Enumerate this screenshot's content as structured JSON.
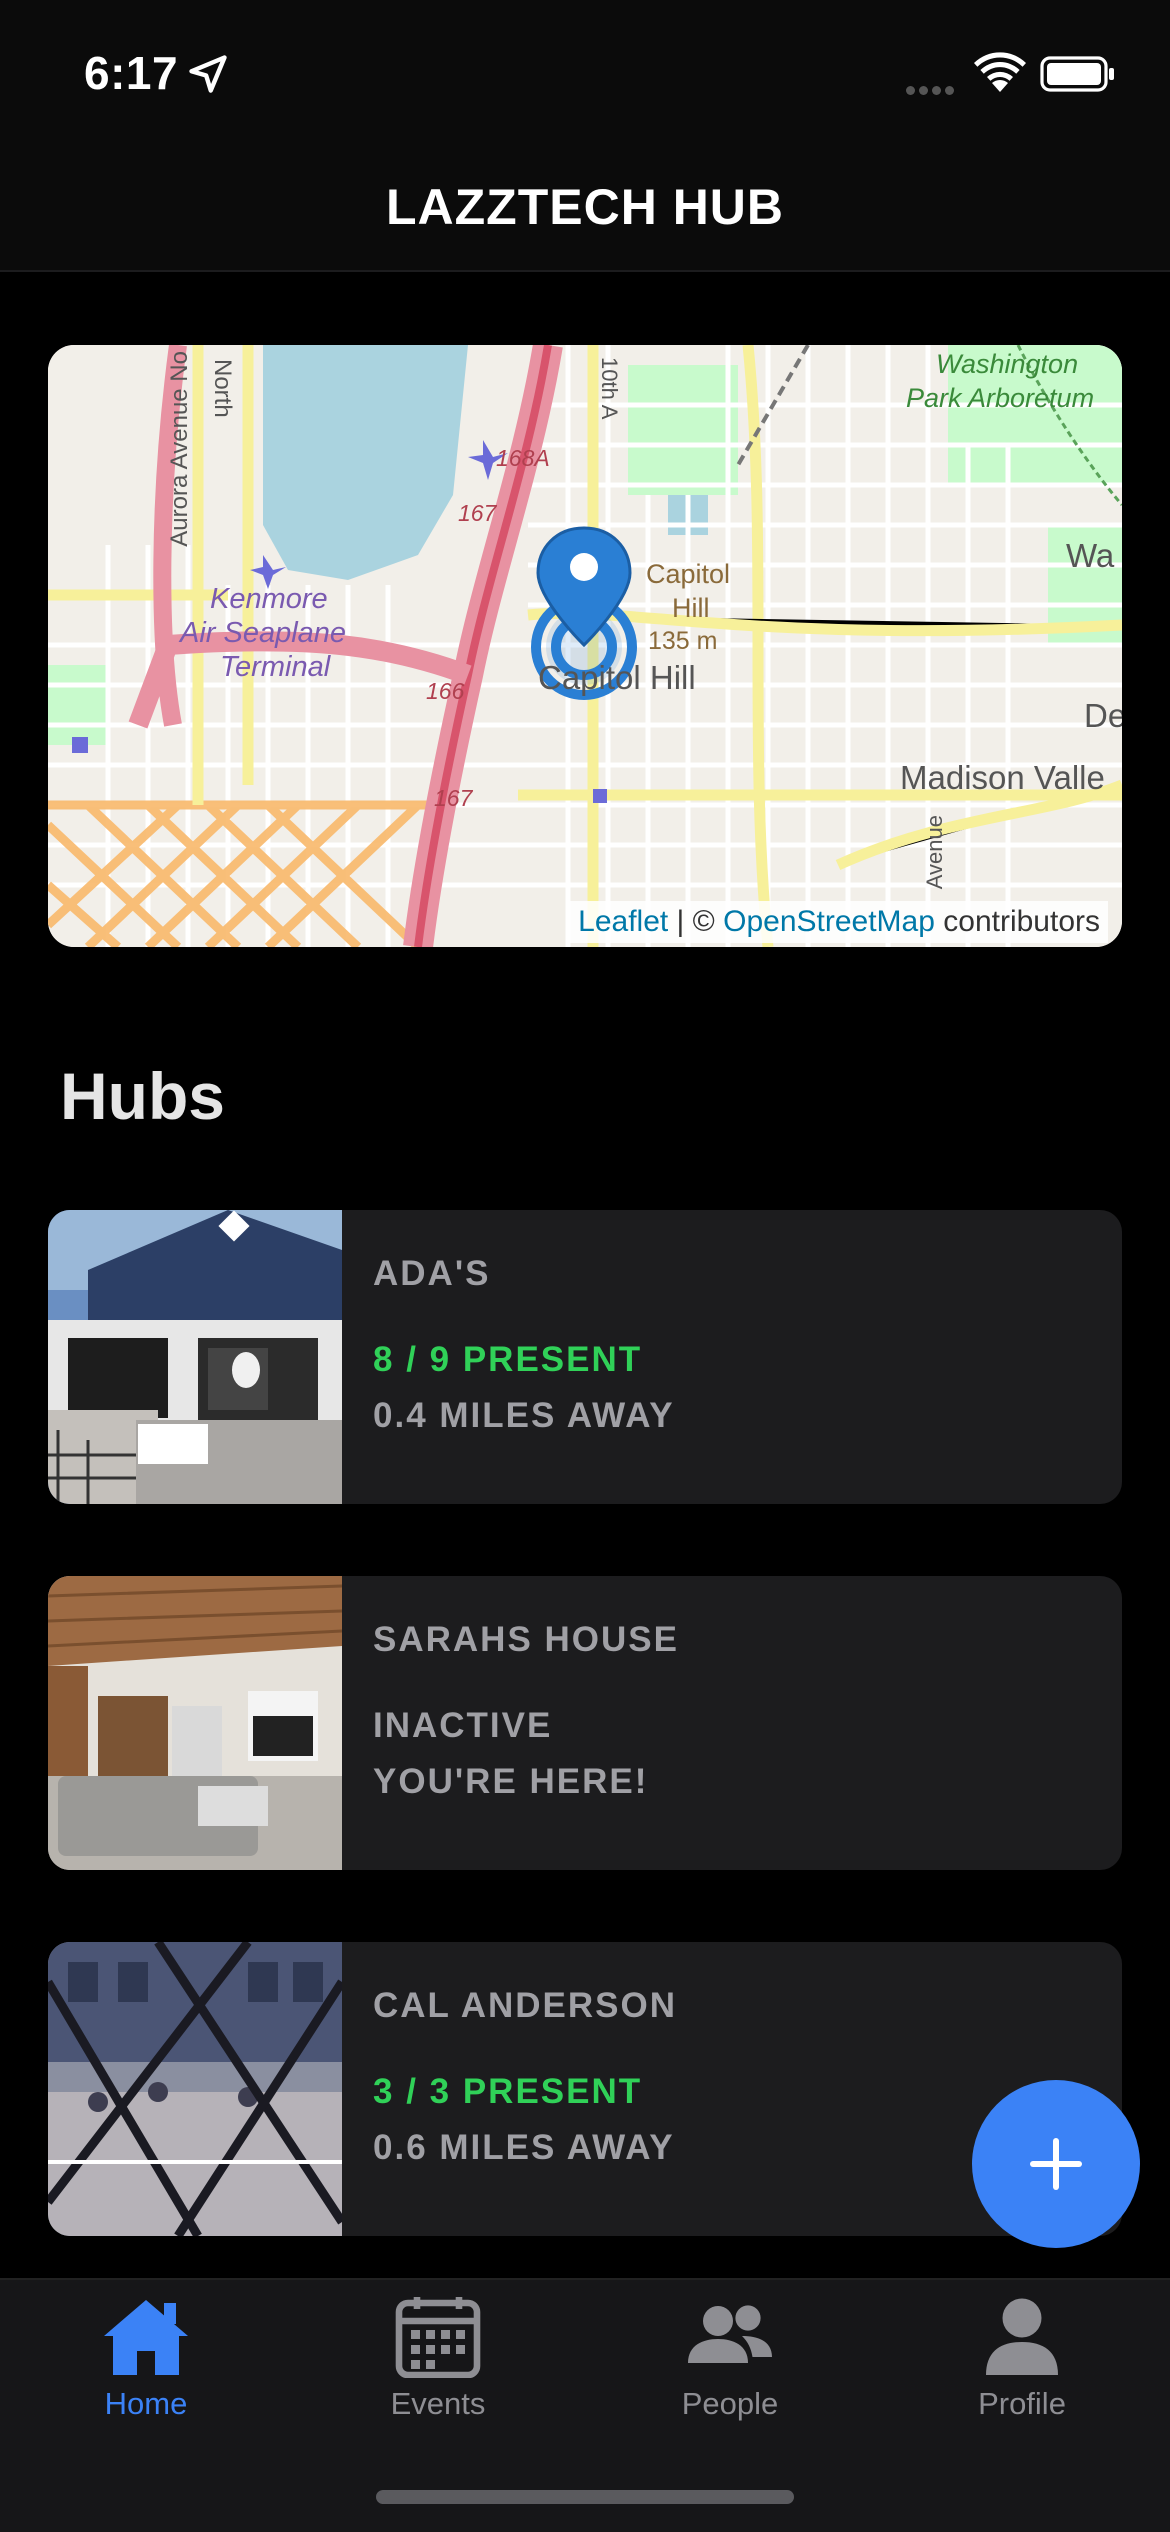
{
  "status_bar": {
    "time": "6:17"
  },
  "nav": {
    "title": "LAZZTECH HUB"
  },
  "map": {
    "labels": {
      "aurora": "Aurora Avenue No",
      "north": "North",
      "kenmore1": "Kenmore",
      "kenmore2": "Air Seaplane",
      "kenmore3": "Terminal",
      "exit168a": "168A",
      "exit167a": "167",
      "exit166": "166",
      "exit167b": "167",
      "tenth": "10th A",
      "washington1": "Washington",
      "washington2": "Park Arboretum",
      "capitol1": "Capitol",
      "capitol2": "Hill",
      "elev": "135 m",
      "capitol_hill": "Capitol Hill",
      "wa": "Wa",
      "de": "De",
      "madison": "Madison Valle",
      "avenue": "Avenue"
    },
    "attribution": {
      "leaflet": "Leaflet",
      "sep": " | © ",
      "osm": "OpenStreetMap",
      "contrib": " contributors"
    }
  },
  "section": {
    "title": "Hubs"
  },
  "hubs": [
    {
      "name": "ADA'S",
      "status": "8 / 9 PRESENT",
      "distance": "0.4 MILES AWAY",
      "image": "bookstore-photo"
    },
    {
      "name": "SARAHS HOUSE",
      "status": "INACTIVE",
      "distance": "YOU'RE HERE!",
      "image": "living-room-photo"
    },
    {
      "name": "CAL ANDERSON",
      "status": "3 / 3 PRESENT",
      "distance": "0.6 MILES AWAY",
      "image": "park-court-photo"
    }
  ],
  "colors": {
    "accent": "#3b82f6",
    "present": "#30d158",
    "muted": "#a0a0a5"
  },
  "tabs": [
    {
      "label": "Home",
      "icon": "house-icon",
      "active": true
    },
    {
      "label": "Events",
      "icon": "calendar-icon",
      "active": false
    },
    {
      "label": "People",
      "icon": "people-icon",
      "active": false
    },
    {
      "label": "Profile",
      "icon": "person-icon",
      "active": false
    }
  ]
}
